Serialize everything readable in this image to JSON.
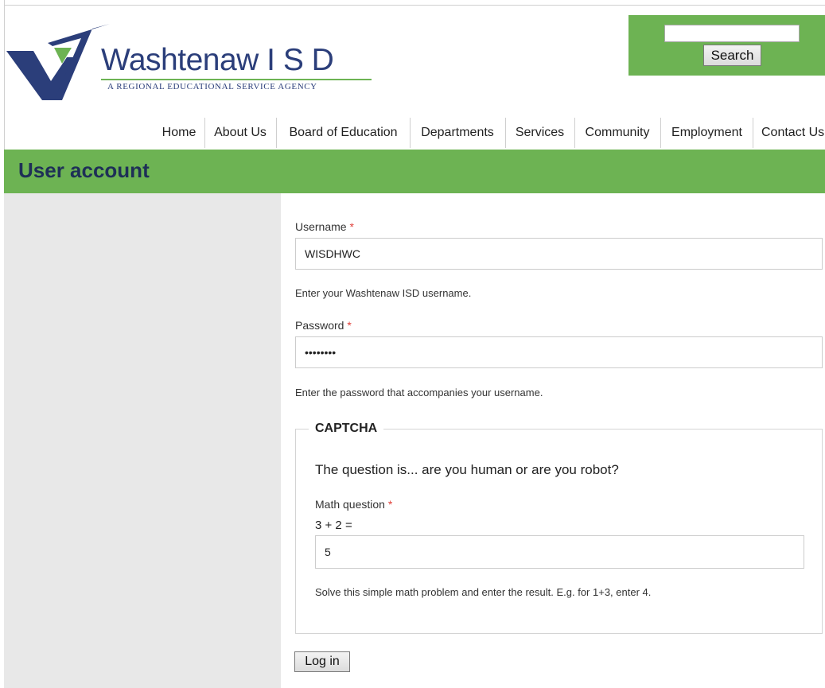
{
  "header": {
    "logo_name": "Washtenaw I S D",
    "logo_tagline": "A REGIONAL EDUCATIONAL SERVICE AGENCY",
    "search": {
      "value": "",
      "button_label": "Search"
    }
  },
  "nav": {
    "items": [
      {
        "label": "Home"
      },
      {
        "label": "About Us"
      },
      {
        "label": "Board of Education"
      },
      {
        "label": "Departments"
      },
      {
        "label": "Services"
      },
      {
        "label": "Community"
      },
      {
        "label": "Employment"
      },
      {
        "label": "Contact Us"
      }
    ]
  },
  "page": {
    "title": "User account"
  },
  "form": {
    "username": {
      "label": "Username",
      "required_mark": "*",
      "value": "WISDHWC",
      "description": "Enter your Washtenaw ISD username."
    },
    "password": {
      "label": "Password",
      "required_mark": "*",
      "value": "••••••••",
      "description": "Enter the password that accompanies your username."
    },
    "captcha": {
      "legend": "CAPTCHA",
      "question": "The question is... are you human or are you robot?",
      "math_label": "Math question",
      "required_mark": "*",
      "problem": "3 + 2 =",
      "value": "5",
      "description": "Solve this simple math problem and enter the result. E.g. for 1+3, enter 4."
    },
    "submit_label": "Log in"
  },
  "colors": {
    "accent_green": "#6db353",
    "brand_navy": "#2b3e7a",
    "title_text": "#1e2f57",
    "required": "#e0403a"
  }
}
